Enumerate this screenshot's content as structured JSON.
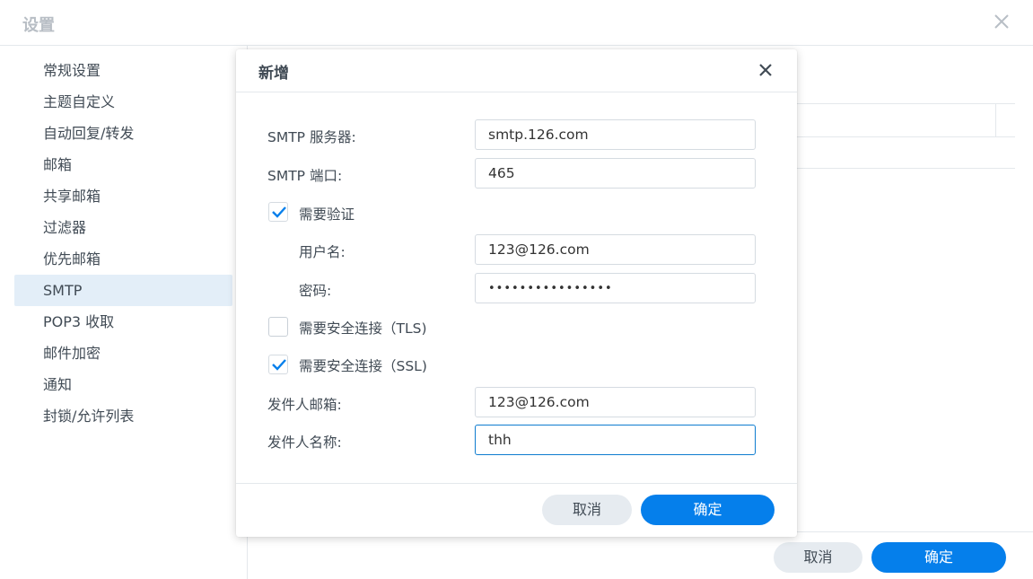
{
  "window": {
    "title": "设置",
    "close_icon": "close-icon"
  },
  "sidebar": {
    "items": [
      {
        "label": "常规设置"
      },
      {
        "label": "主题自定义"
      },
      {
        "label": "自动回复/转发"
      },
      {
        "label": "邮箱"
      },
      {
        "label": "共享邮箱"
      },
      {
        "label": "过滤器"
      },
      {
        "label": "优先邮箱"
      },
      {
        "label": "SMTP",
        "active": true
      },
      {
        "label": "POP3 收取"
      },
      {
        "label": "邮件加密"
      },
      {
        "label": "通知"
      },
      {
        "label": "封锁/允许列表"
      }
    ]
  },
  "footer": {
    "cancel_label": "取消",
    "ok_label": "确定"
  },
  "dialog": {
    "title": "新增",
    "smtp_server": {
      "label": "SMTP 服务器:",
      "value": "smtp.126.com"
    },
    "smtp_port": {
      "label": "SMTP 端口:",
      "value": "465"
    },
    "require_auth": {
      "label": "需要验证",
      "checked": true
    },
    "username": {
      "label": "用户名:",
      "value": "123@126.com"
    },
    "password": {
      "label": "密码:",
      "value": "••••••••••••••••"
    },
    "tls": {
      "label": "需要安全连接（TLS)",
      "checked": false
    },
    "ssl": {
      "label": "需要安全连接（SSL)",
      "checked": true
    },
    "sender_email": {
      "label": "发件人邮箱:",
      "value": "123@126.com"
    },
    "sender_name": {
      "label": "发件人名称:",
      "value": "thh"
    },
    "cancel_label": "取消",
    "ok_label": "确定"
  },
  "colors": {
    "accent": "#057feb",
    "secondary_button": "#e6ebf0",
    "active_sidebar": "#e3eef8",
    "text": "#414b55"
  }
}
